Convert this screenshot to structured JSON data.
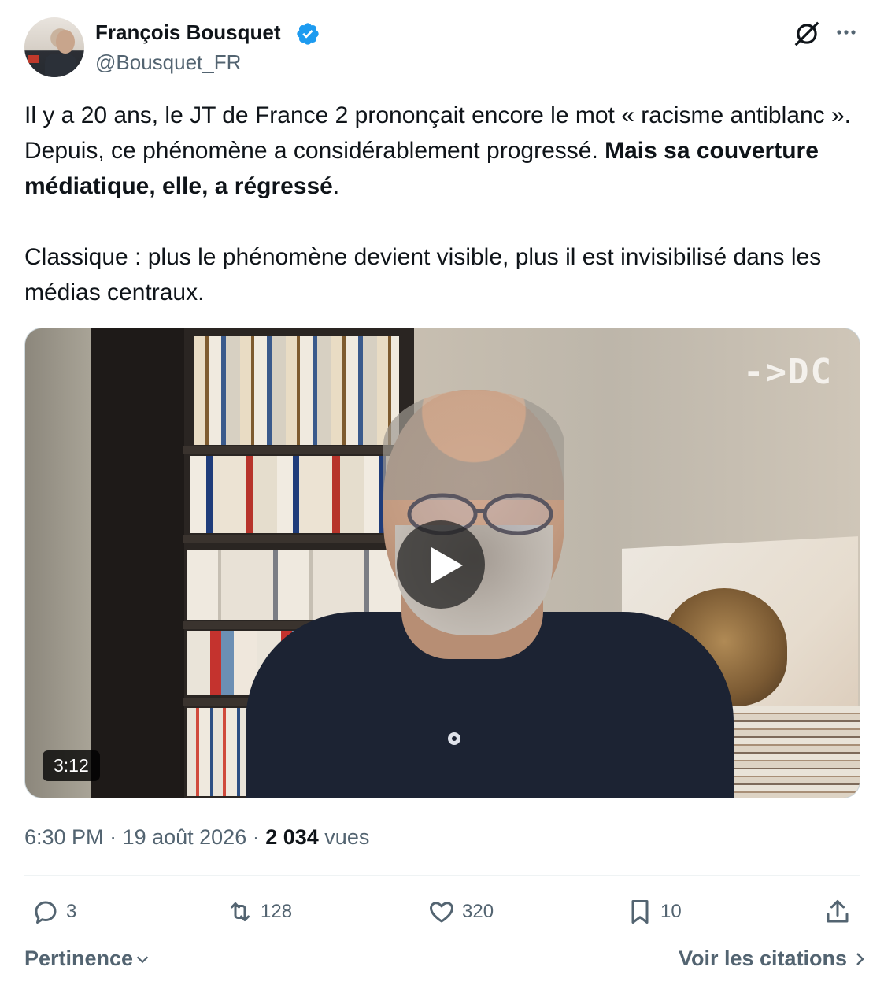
{
  "author": {
    "name": "François Bousquet",
    "handle": "@Bousquet_FR",
    "verified": true,
    "verified_color": "#1d9bf0"
  },
  "header_actions": {
    "grok_icon": "grok-icon",
    "more_icon": "more-icon"
  },
  "tweet": {
    "p1_a": "Il y a 20 ans, le JT de France 2 prononçait encore le mot « racisme antiblanc ». Depuis, ce phénomène a considérablement progressé. ",
    "p1_bold": "Mais sa couverture médiatique, elle, a régressé",
    "p1_end": ".",
    "p2": "Classique : plus le phénomène devient visible, plus il est invisibilisé dans les médias centraux."
  },
  "video": {
    "overlay_logo": "->DC",
    "duration": "3:12"
  },
  "meta": {
    "time": "6:30 PM",
    "sep1": " · ",
    "date": "19 août 2026",
    "sep2": " · ",
    "views_count": "2 034",
    "views_label": " vues"
  },
  "actions": {
    "reply_count": "3",
    "retweet_count": "128",
    "like_count": "320",
    "bookmark_count": "10"
  },
  "footer": {
    "sort_label": "Pertinence",
    "quotes_label": "Voir les citations"
  },
  "colors": {
    "text": "#0f1419",
    "secondary": "#536471",
    "accent": "#1d9bf0"
  }
}
